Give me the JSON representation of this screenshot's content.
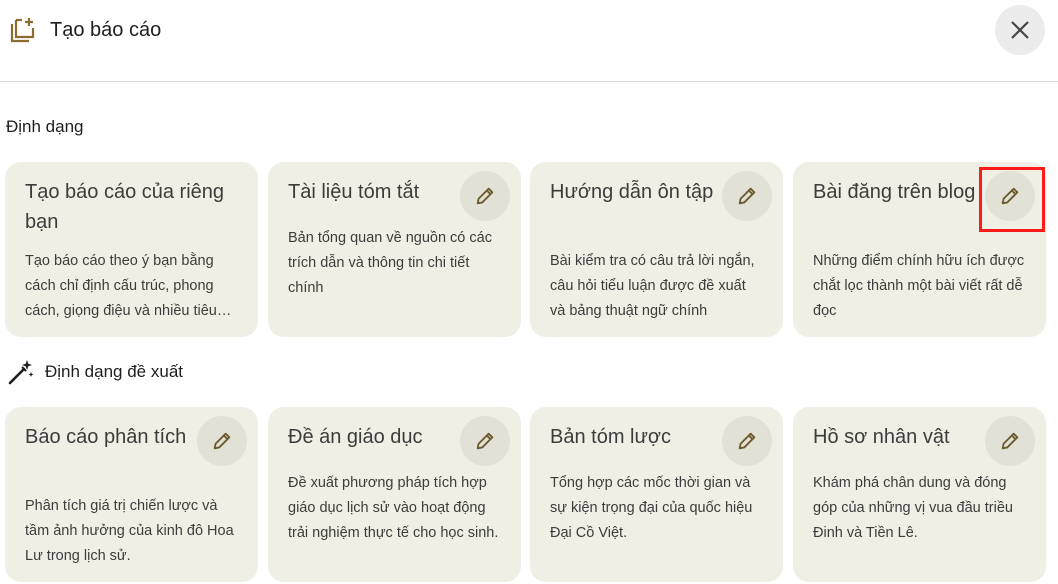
{
  "header": {
    "title": "Tạo báo cáo",
    "icon": "report-create-icon",
    "close_icon": "close-icon"
  },
  "formats": {
    "section_title": "Định dạng",
    "cards": [
      {
        "title": "Tạo báo cáo của riêng bạn",
        "description": "Tạo báo cáo theo ý bạn bằng cách chỉ định cấu trúc, phong cách, giọng điệu và nhiều tiêu chí khác"
      },
      {
        "title": "Tài liệu tóm tắt",
        "description": "Bản tổng quan về nguồn có các trích dẫn và thông tin chi tiết chính"
      },
      {
        "title": "Hướng dẫn ôn tập",
        "description": "Bài kiểm tra có câu trả lời ngắn, câu hỏi tiểu luận được đề xuất và bảng thuật ngữ chính"
      },
      {
        "title": "Bài đăng trên blog",
        "description": "Những điểm chính hữu ích được chắt lọc thành một bài viết rất dễ đọc"
      }
    ]
  },
  "suggested": {
    "section_title": "Định dạng đề xuất",
    "icon": "magic-wand-icon",
    "cards": [
      {
        "title": "Báo cáo phân tích",
        "description": "Phân tích giá trị chiến lược và tầm ảnh hưởng của kinh đô Hoa Lư trong lịch sử."
      },
      {
        "title": "Đề án giáo dục",
        "description": "Đề xuất phương pháp tích hợp giáo dục lịch sử vào hoạt động trải nghiệm thực tế cho học sinh."
      },
      {
        "title": "Bản tóm lược",
        "description": "Tổng hợp các mốc thời gian và sự kiện trọng đại của quốc hiệu Đại Cồ Việt."
      },
      {
        "title": "Hồ sơ nhân vật",
        "description": "Khám phá chân dung và đóng góp của những vị vua đầu triều Đinh và Tiền Lê."
      }
    ]
  },
  "colors": {
    "card_bg": "#f0efe5",
    "edit_btn_bg": "#e2e1d6",
    "pencil": "#6b5a2e",
    "highlight": "#ff1a1a"
  }
}
